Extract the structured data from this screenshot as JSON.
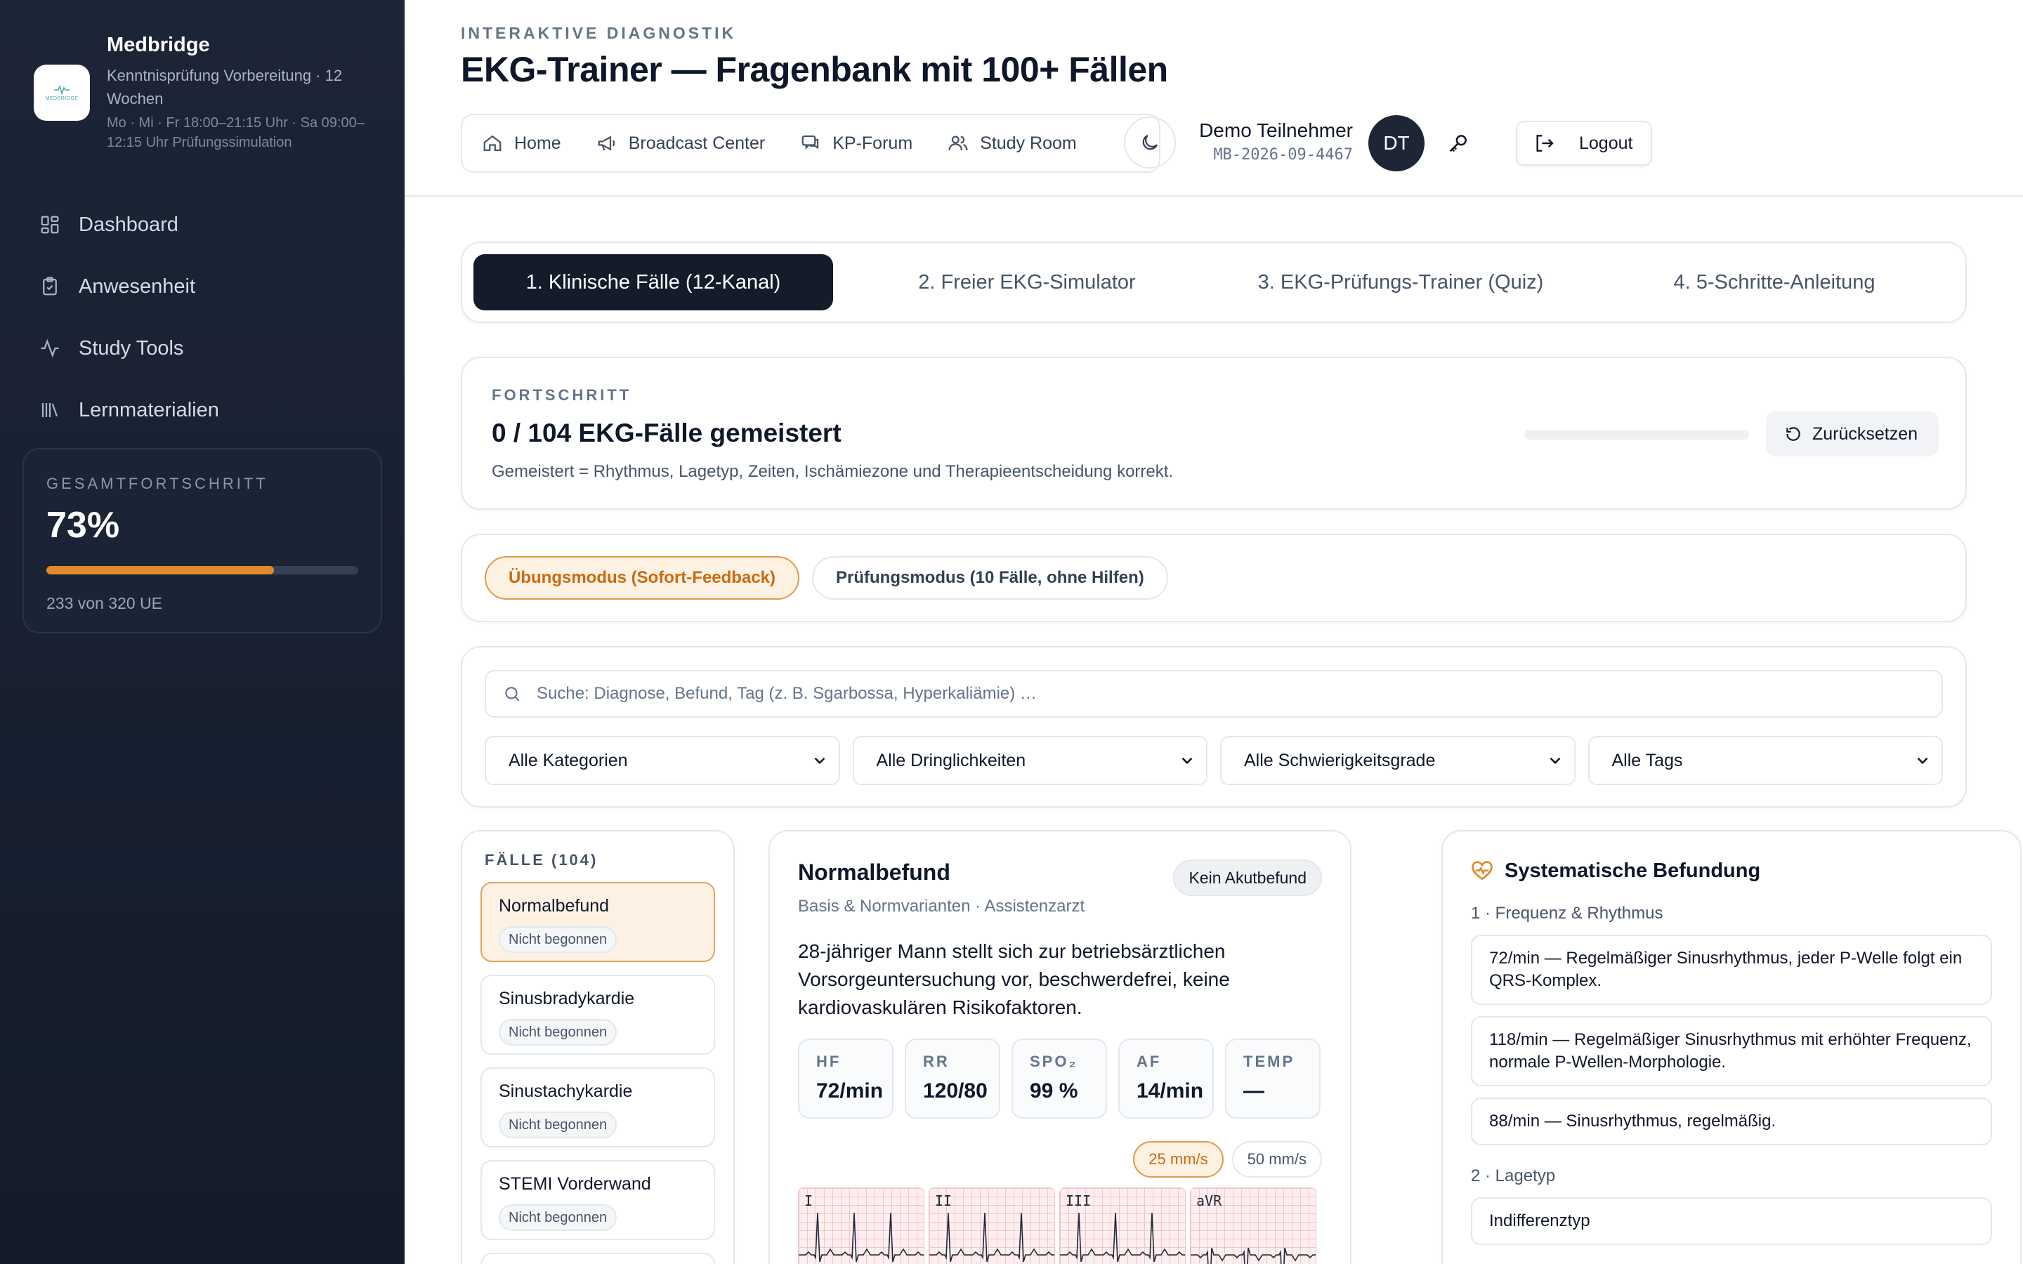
{
  "sidebar": {
    "brand": {
      "name": "Medbridge",
      "subtitle": "Kenntnisprüfung Vorbereitung · 12 Wochen",
      "schedule": "Mo · Mi · Fr 18:00–21:15 Uhr · Sa 09:00–12:15 Uhr Prüfungssimulation",
      "logo_text": "MEDBRIDGE"
    },
    "nav": [
      {
        "label": "Dashboard",
        "icon": "dashboard-icon"
      },
      {
        "label": "Anwesenheit",
        "icon": "clipboard-check-icon"
      },
      {
        "label": "Study Tools",
        "icon": "activity-icon"
      },
      {
        "label": "Lernmaterialien",
        "icon": "library-icon"
      }
    ],
    "progress": {
      "label": "GESAMTFORTSCHRITT",
      "value": "73%",
      "fraction": 0.73,
      "foot": "233 von 320 UE"
    }
  },
  "header": {
    "eyebrow": "INTERAKTIVE DIAGNOSTIK",
    "title": "EKG-Trainer — Fragenbank mit 100+ Fällen",
    "nav": [
      {
        "label": "Home",
        "icon": "home-icon"
      },
      {
        "label": "Broadcast Center",
        "icon": "megaphone-icon"
      },
      {
        "label": "KP-Forum",
        "icon": "chat-icon"
      },
      {
        "label": "Study Room",
        "icon": "users-icon"
      }
    ],
    "user": {
      "name": "Demo Teilnehmer",
      "id": "MB-2026-09-4467",
      "initials": "DT"
    },
    "logout_label": "Logout"
  },
  "tabs": [
    {
      "label": "1. Klinische Fälle (12-Kanal)",
      "active": true
    },
    {
      "label": "2. Freier EKG-Simulator",
      "active": false
    },
    {
      "label": "3. EKG-Prüfungs-Trainer (Quiz)",
      "active": false
    },
    {
      "label": "4. 5-Schritte-Anleitung",
      "active": false
    }
  ],
  "progress_panel": {
    "eyebrow": "FORTSCHRITT",
    "title": "0 / 104 EKG-Fälle gemeistert",
    "description": "Gemeistert = Rhythmus, Lagetyp, Zeiten, Ischämiezone und Therapieentscheidung korrekt.",
    "fraction": 0,
    "reset_label": "Zurücksetzen"
  },
  "modes": [
    {
      "label": "Übungsmodus (Sofort-Feedback)",
      "active": true
    },
    {
      "label": "Prüfungsmodus (10 Fälle, ohne Hilfen)",
      "active": false
    }
  ],
  "filters": {
    "search_placeholder": "Suche: Diagnose, Befund, Tag (z. B. Sgarbossa, Hyperkaliämie) …",
    "selects": [
      "Alle Kategorien",
      "Alle Dringlichkeiten",
      "Alle Schwierigkeitsgrade",
      "Alle Tags"
    ]
  },
  "cases": {
    "title": "FÄLLE (104)",
    "items": [
      {
        "name": "Normalbefund",
        "status": "Nicht begonnen",
        "active": true
      },
      {
        "name": "Sinusbradykardie",
        "status": "Nicht begonnen",
        "active": false
      },
      {
        "name": "Sinustachykardie",
        "status": "Nicht begonnen",
        "active": false
      },
      {
        "name": "STEMI Vorderwand",
        "status": "Nicht begonnen",
        "active": false
      }
    ]
  },
  "case_detail": {
    "title": "Normalbefund",
    "badge": "Kein Akutbefund",
    "subtitle": "Basis & Normvarianten · Assistenzarzt",
    "text": "28-jähriger Mann stellt sich zur betriebsärztlichen Vorsorgeuntersuchung vor, beschwerdefrei, keine kardiovaskulären Risikofaktoren.",
    "vitals": [
      {
        "label": "HF",
        "value": "72/min"
      },
      {
        "label": "RR",
        "value": "120/80"
      },
      {
        "label": "SPO₂",
        "value": "99 %"
      },
      {
        "label": "AF",
        "value": "14/min"
      },
      {
        "label": "TEMP",
        "value": "—"
      }
    ],
    "speeds": [
      {
        "label": "25 mm/s",
        "active": true
      },
      {
        "label": "50 mm/s",
        "active": false
      }
    ],
    "leads": [
      "I",
      "II",
      "III",
      "aVR"
    ]
  },
  "findings": {
    "title": "Systematische Befundung",
    "sections": [
      {
        "label": "1 · Frequenz & Rhythmus",
        "options": [
          "72/min — Regelmäßiger Sinusrhythmus, jeder P-Welle folgt ein QRS-Komplex.",
          "118/min — Regelmäßiger Sinusrhythmus mit erhöhter Frequenz, normale P-Wellen-Morphologie.",
          "88/min — Sinusrhythmus, regelmäßig."
        ]
      },
      {
        "label": "2 · Lagetyp",
        "options": [
          "Indifferenztyp"
        ]
      }
    ]
  },
  "colors": {
    "accent": "#e08a2c",
    "dark": "#141b2b",
    "ecg_grid": "#f3c4c9"
  }
}
